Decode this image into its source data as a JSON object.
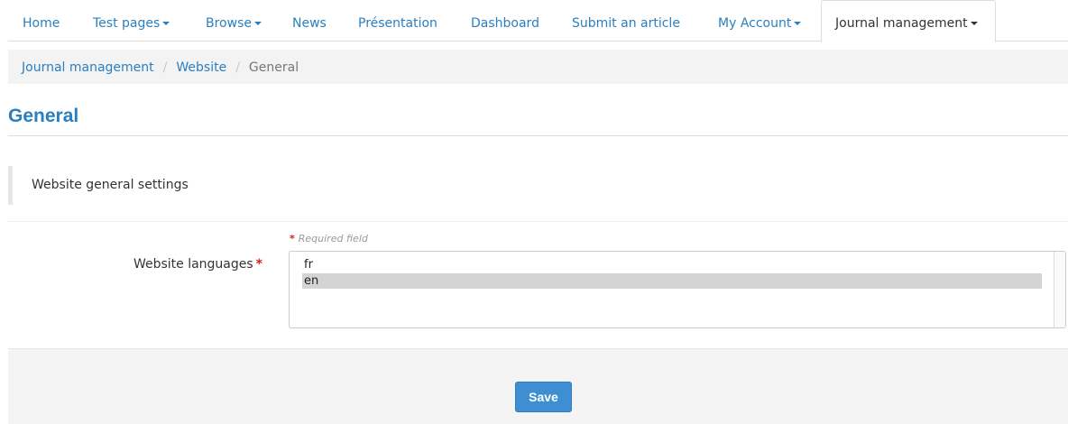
{
  "nav": {
    "items": [
      {
        "label": "Home",
        "dropdown": false
      },
      {
        "label": "Test pages",
        "dropdown": true
      },
      {
        "label": "Browse",
        "dropdown": true
      },
      {
        "label": "News",
        "dropdown": false
      },
      {
        "label": "Présentation",
        "dropdown": false
      },
      {
        "label": "Dashboard",
        "dropdown": false
      },
      {
        "label": "Submit an article",
        "dropdown": false
      },
      {
        "label": "My Account",
        "dropdown": true
      },
      {
        "label": "Journal management",
        "dropdown": true,
        "active": true
      }
    ]
  },
  "breadcrumb": {
    "items": [
      "Journal management",
      "Website"
    ],
    "separator": "/",
    "current": "General"
  },
  "page": {
    "title": "General",
    "description": "Website general settings"
  },
  "form": {
    "required_note": "Required field",
    "required_marker": "*",
    "languages_label": "Website languages",
    "languages_options": [
      "fr",
      "en"
    ],
    "languages_selected": "en",
    "save_label": "Save"
  },
  "colors": {
    "link": "#2a7fc0",
    "primary_button": "#3e8fd2",
    "required": "#cc2222"
  }
}
